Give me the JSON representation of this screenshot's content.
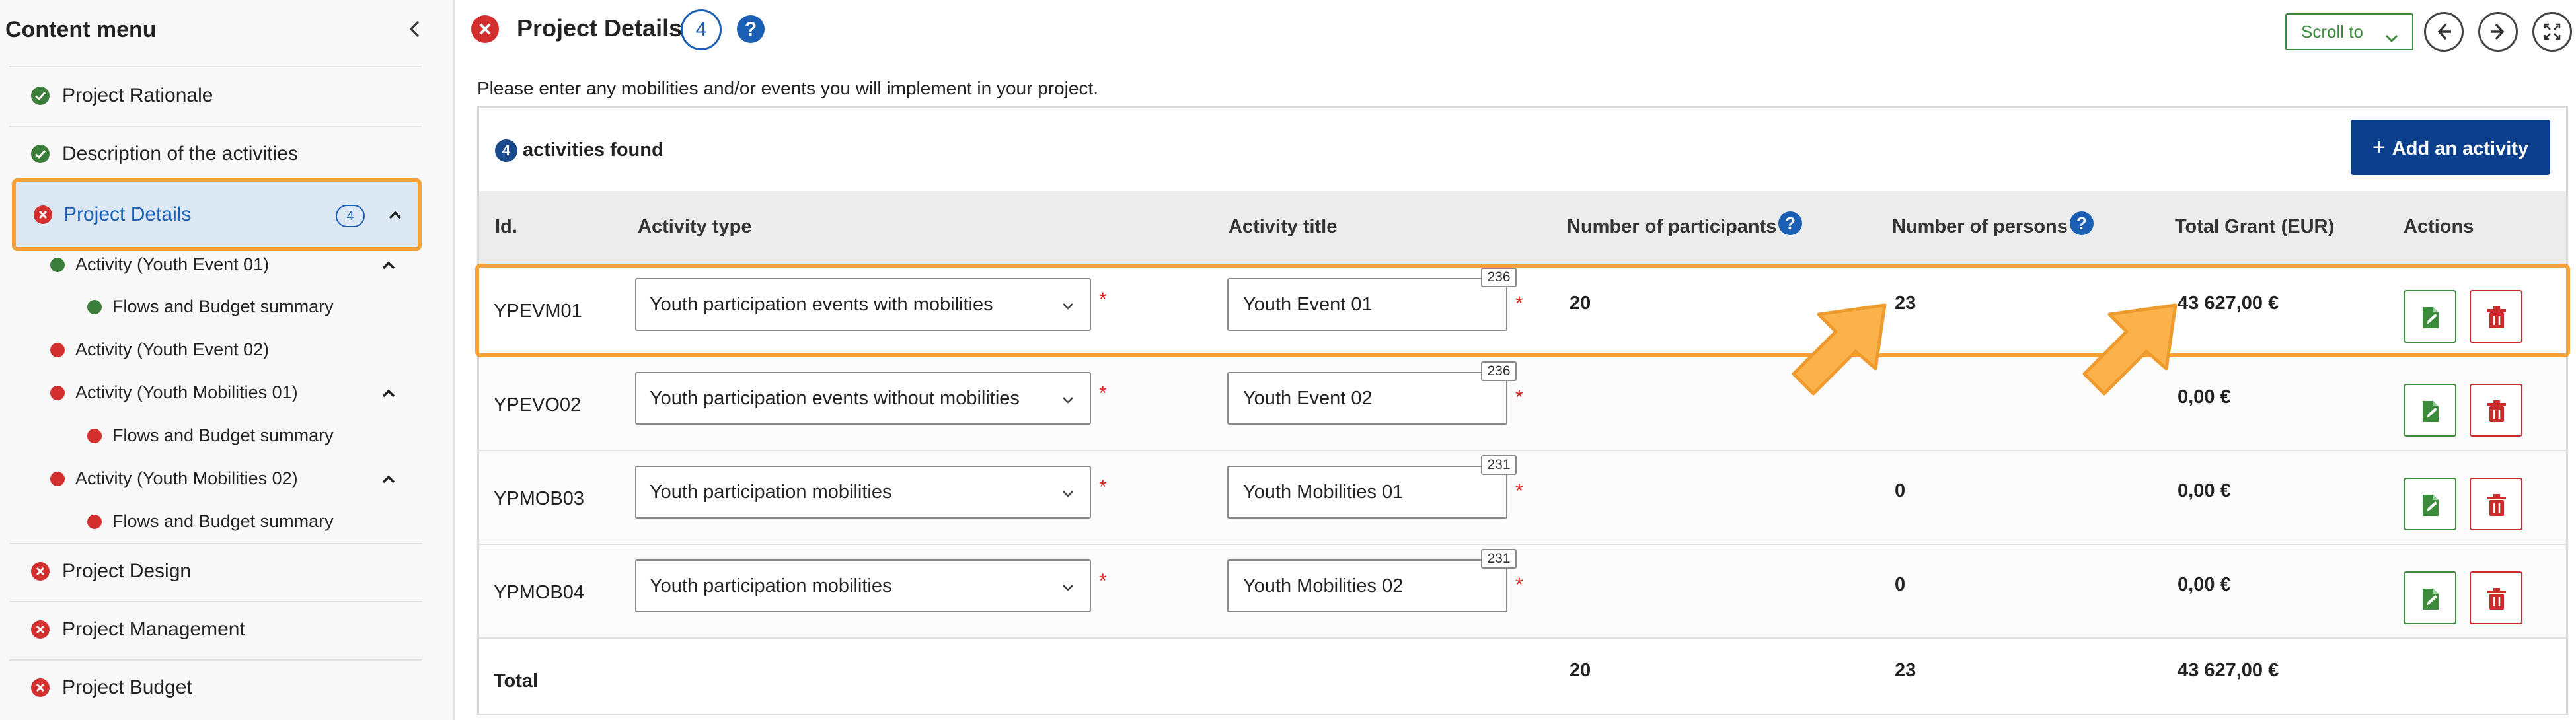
{
  "sidebar": {
    "title": "Content menu",
    "items": [
      {
        "label": "Project Rationale",
        "status": "complete"
      },
      {
        "label": "Description of the activities",
        "status": "complete"
      },
      {
        "label": "Project Details",
        "status": "error",
        "badge": "4"
      },
      {
        "label": "Project Design",
        "status": "error"
      },
      {
        "label": "Project Management",
        "status": "error"
      },
      {
        "label": "Project Budget",
        "status": "error"
      }
    ],
    "subitems": [
      {
        "label": "Activity (Youth Event 01)"
      },
      {
        "label": "Flows and Budget summary"
      },
      {
        "label": "Activity (Youth Event 02)"
      },
      {
        "label": "Activity (Youth Mobilities 01)"
      },
      {
        "label": "Flows and Budget summary"
      },
      {
        "label": "Activity (Youth Mobilities 02)"
      },
      {
        "label": "Flows and Budget summary"
      }
    ]
  },
  "header": {
    "title": "Project Details",
    "badge": "4",
    "scroll_to": "Scroll to",
    "intro": "Please enter any mobilities and/or events you will implement in your project."
  },
  "panel": {
    "found_count": "4",
    "found_label": "activities found",
    "add_label": "Add an activity"
  },
  "table": {
    "headers": [
      "Id.",
      "Activity type",
      "Activity title",
      "Number of participants",
      "Number of persons",
      "Total Grant (EUR)",
      "Actions"
    ],
    "rows": [
      {
        "id": "YPEVM01",
        "type": "Youth participation events with mobilities",
        "title": "Youth Event 01",
        "counter": "236",
        "participants": "20",
        "persons": "23",
        "grant": "43 627,00 €"
      },
      {
        "id": "YPEVO02",
        "type": "Youth participation events without mobilities",
        "title": "Youth Event 02",
        "counter": "236",
        "participants": "",
        "persons": "",
        "grant": "0,00 €"
      },
      {
        "id": "YPMOB03",
        "type": "Youth participation mobilities",
        "title": "Youth Mobilities 01",
        "counter": "231",
        "participants": "",
        "persons": "0",
        "grant": "0,00 €"
      },
      {
        "id": "YPMOB04",
        "type": "Youth participation mobilities",
        "title": "Youth Mobilities 02",
        "counter": "231",
        "participants": "",
        "persons": "0",
        "grant": "0,00 €"
      }
    ],
    "total": {
      "label": "Total",
      "participants": "20",
      "persons": "23",
      "grant": "43 627,00 €"
    },
    "required_mark": "*"
  },
  "colors": {
    "accent_blue": "#1a5fb4",
    "complete_green": "#3b7d3b",
    "error_red": "#d32f2f",
    "highlight_orange": "#f4a13a",
    "primary_button": "#0b3f8c"
  }
}
